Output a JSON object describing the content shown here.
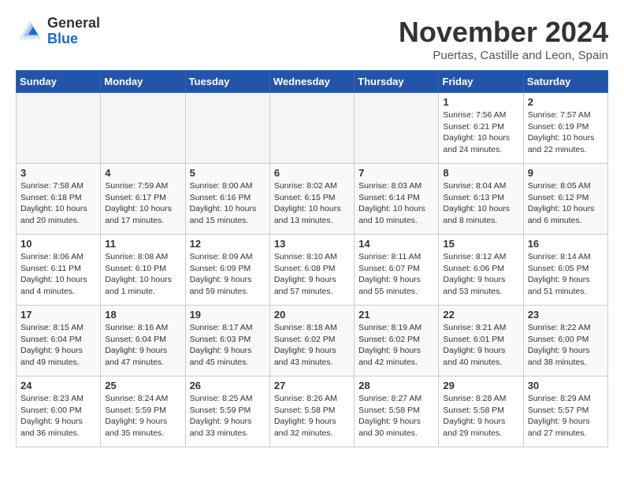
{
  "logo": {
    "general": "General",
    "blue": "Blue"
  },
  "title": "November 2024",
  "location": "Puertas, Castille and Leon, Spain",
  "days_header": [
    "Sunday",
    "Monday",
    "Tuesday",
    "Wednesday",
    "Thursday",
    "Friday",
    "Saturday"
  ],
  "weeks": [
    [
      {
        "day": "",
        "info": ""
      },
      {
        "day": "",
        "info": ""
      },
      {
        "day": "",
        "info": ""
      },
      {
        "day": "",
        "info": ""
      },
      {
        "day": "",
        "info": ""
      },
      {
        "day": "1",
        "info": "Sunrise: 7:56 AM\nSunset: 6:21 PM\nDaylight: 10 hours\nand 24 minutes."
      },
      {
        "day": "2",
        "info": "Sunrise: 7:57 AM\nSunset: 6:19 PM\nDaylight: 10 hours\nand 22 minutes."
      }
    ],
    [
      {
        "day": "3",
        "info": "Sunrise: 7:58 AM\nSunset: 6:18 PM\nDaylight: 10 hours\nand 20 minutes."
      },
      {
        "day": "4",
        "info": "Sunrise: 7:59 AM\nSunset: 6:17 PM\nDaylight: 10 hours\nand 17 minutes."
      },
      {
        "day": "5",
        "info": "Sunrise: 8:00 AM\nSunset: 6:16 PM\nDaylight: 10 hours\nand 15 minutes."
      },
      {
        "day": "6",
        "info": "Sunrise: 8:02 AM\nSunset: 6:15 PM\nDaylight: 10 hours\nand 13 minutes."
      },
      {
        "day": "7",
        "info": "Sunrise: 8:03 AM\nSunset: 6:14 PM\nDaylight: 10 hours\nand 10 minutes."
      },
      {
        "day": "8",
        "info": "Sunrise: 8:04 AM\nSunset: 6:13 PM\nDaylight: 10 hours\nand 8 minutes."
      },
      {
        "day": "9",
        "info": "Sunrise: 8:05 AM\nSunset: 6:12 PM\nDaylight: 10 hours\nand 6 minutes."
      }
    ],
    [
      {
        "day": "10",
        "info": "Sunrise: 8:06 AM\nSunset: 6:11 PM\nDaylight: 10 hours\nand 4 minutes."
      },
      {
        "day": "11",
        "info": "Sunrise: 8:08 AM\nSunset: 6:10 PM\nDaylight: 10 hours\nand 1 minute."
      },
      {
        "day": "12",
        "info": "Sunrise: 8:09 AM\nSunset: 6:09 PM\nDaylight: 9 hours\nand 59 minutes."
      },
      {
        "day": "13",
        "info": "Sunrise: 8:10 AM\nSunset: 6:08 PM\nDaylight: 9 hours\nand 57 minutes."
      },
      {
        "day": "14",
        "info": "Sunrise: 8:11 AM\nSunset: 6:07 PM\nDaylight: 9 hours\nand 55 minutes."
      },
      {
        "day": "15",
        "info": "Sunrise: 8:12 AM\nSunset: 6:06 PM\nDaylight: 9 hours\nand 53 minutes."
      },
      {
        "day": "16",
        "info": "Sunrise: 8:14 AM\nSunset: 6:05 PM\nDaylight: 9 hours\nand 51 minutes."
      }
    ],
    [
      {
        "day": "17",
        "info": "Sunrise: 8:15 AM\nSunset: 6:04 PM\nDaylight: 9 hours\nand 49 minutes."
      },
      {
        "day": "18",
        "info": "Sunrise: 8:16 AM\nSunset: 6:04 PM\nDaylight: 9 hours\nand 47 minutes."
      },
      {
        "day": "19",
        "info": "Sunrise: 8:17 AM\nSunset: 6:03 PM\nDaylight: 9 hours\nand 45 minutes."
      },
      {
        "day": "20",
        "info": "Sunrise: 8:18 AM\nSunset: 6:02 PM\nDaylight: 9 hours\nand 43 minutes."
      },
      {
        "day": "21",
        "info": "Sunrise: 8:19 AM\nSunset: 6:02 PM\nDaylight: 9 hours\nand 42 minutes."
      },
      {
        "day": "22",
        "info": "Sunrise: 8:21 AM\nSunset: 6:01 PM\nDaylight: 9 hours\nand 40 minutes."
      },
      {
        "day": "23",
        "info": "Sunrise: 8:22 AM\nSunset: 6:00 PM\nDaylight: 9 hours\nand 38 minutes."
      }
    ],
    [
      {
        "day": "24",
        "info": "Sunrise: 8:23 AM\nSunset: 6:00 PM\nDaylight: 9 hours\nand 36 minutes."
      },
      {
        "day": "25",
        "info": "Sunrise: 8:24 AM\nSunset: 5:59 PM\nDaylight: 9 hours\nand 35 minutes."
      },
      {
        "day": "26",
        "info": "Sunrise: 8:25 AM\nSunset: 5:59 PM\nDaylight: 9 hours\nand 33 minutes."
      },
      {
        "day": "27",
        "info": "Sunrise: 8:26 AM\nSunset: 5:58 PM\nDaylight: 9 hours\nand 32 minutes."
      },
      {
        "day": "28",
        "info": "Sunrise: 8:27 AM\nSunset: 5:58 PM\nDaylight: 9 hours\nand 30 minutes."
      },
      {
        "day": "29",
        "info": "Sunrise: 8:28 AM\nSunset: 5:58 PM\nDaylight: 9 hours\nand 29 minutes."
      },
      {
        "day": "30",
        "info": "Sunrise: 8:29 AM\nSunset: 5:57 PM\nDaylight: 9 hours\nand 27 minutes."
      }
    ]
  ]
}
